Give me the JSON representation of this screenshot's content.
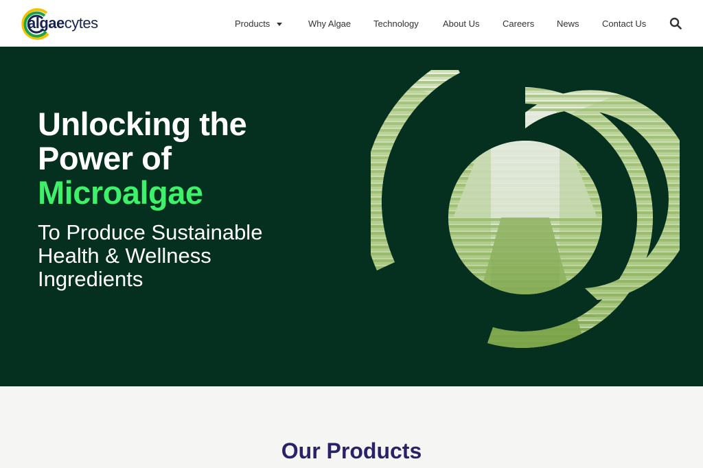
{
  "logo": {
    "part1": "algae",
    "part2": "cytes"
  },
  "nav": {
    "items": [
      {
        "label": "Products",
        "has_dropdown": true
      },
      {
        "label": "Why Algae"
      },
      {
        "label": "Technology"
      },
      {
        "label": "About Us"
      },
      {
        "label": "Careers"
      },
      {
        "label": "News"
      },
      {
        "label": "Contact Us"
      }
    ],
    "search_icon": "search-icon"
  },
  "hero": {
    "title_line1": "Unlocking the",
    "title_line2": "Power of",
    "title_accent": "Microalgae",
    "subtitle_line1": "To Produce Sustainable",
    "subtitle_line2": "Health & Wellness",
    "subtitle_line3": "Ingredients",
    "image": "photobioreactor-tunnel-image"
  },
  "products": {
    "title": "Our Products"
  },
  "colors": {
    "hero_bg": "#05301f",
    "accent_green": "#3ef06a",
    "brand_navy": "#17244f",
    "products_title": "#2a2268",
    "section_bg": "#f5f5f3"
  }
}
